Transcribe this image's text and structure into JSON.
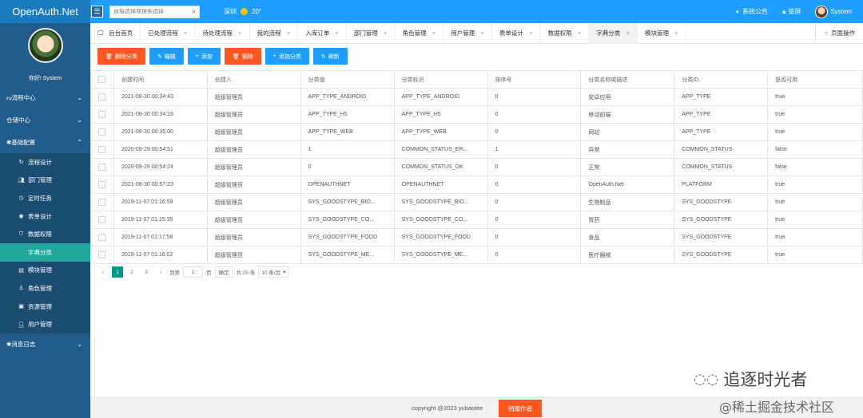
{
  "app": {
    "title": "OpenAuth.Net"
  },
  "header": {
    "search_placeholder": "直接选择或搜索选择",
    "weather": {
      "city": "深圳",
      "temp": "20°"
    },
    "notice": "系统公告",
    "lock": "锁屏",
    "user": "System"
  },
  "sidebar": {
    "greeting": "你好! System",
    "groups": [
      {
        "label": "流程中心",
        "expanded": false
      },
      {
        "label": "仓储中心",
        "expanded": false
      },
      {
        "label": "基础配置",
        "expanded": true
      },
      {
        "label": "消息日志",
        "expanded": false
      }
    ],
    "items": [
      {
        "label": "流程设计",
        "icon": "cycle-icon"
      },
      {
        "label": "部门管理",
        "icon": "users-icon"
      },
      {
        "label": "定时任务",
        "icon": "clock-icon"
      },
      {
        "label": "表单设计",
        "icon": "eye-icon"
      },
      {
        "label": "数据权限",
        "icon": "shield-icon"
      },
      {
        "label": "字典分类",
        "icon": "",
        "active": true
      },
      {
        "label": "模块管理",
        "icon": "list-icon"
      },
      {
        "label": "角色管理",
        "icon": "role-icon"
      },
      {
        "label": "资源管理",
        "icon": "resource-icon"
      },
      {
        "label": "用户管理",
        "icon": "user-icon"
      }
    ]
  },
  "tabs": [
    {
      "label": "后台首页",
      "closable": false
    },
    {
      "label": "已处理流程",
      "closable": true
    },
    {
      "label": "待处理流程",
      "closable": true
    },
    {
      "label": "我的流程",
      "closable": true
    },
    {
      "label": "入库订单",
      "closable": true
    },
    {
      "label": "部门管理",
      "closable": true
    },
    {
      "label": "角色管理",
      "closable": true
    },
    {
      "label": "用户管理",
      "closable": true
    },
    {
      "label": "表单设计",
      "closable": true
    },
    {
      "label": "数据权限",
      "closable": true
    },
    {
      "label": "字典分类",
      "closable": true,
      "active": true
    },
    {
      "label": "模块管理",
      "closable": true
    }
  ],
  "tab_ops": "页面操作",
  "toolbar": {
    "delete_category": "删除分类",
    "edit": "编辑",
    "add": "添加",
    "delete": "删除",
    "add_category": "添加分类",
    "refresh": "刷新"
  },
  "table": {
    "columns": [
      "创建时间",
      "创建人",
      "分类值",
      "分类标识",
      "排序号",
      "分类名称或描述",
      "分类ID",
      "是否可用"
    ],
    "rows": [
      [
        "2021-08-30 00:34:43",
        "超级管理员",
        "APP_TYPE_ANDROID",
        "APP_TYPE_ANDROID",
        "0",
        "安卓应用",
        "APP_TYPE",
        "true"
      ],
      [
        "2021-08-30 00:34:19",
        "超级管理员",
        "APP_TYPE_H5",
        "APP_TYPE_H5",
        "0",
        "移动前端",
        "APP_TYPE",
        "true"
      ],
      [
        "2021-08-30 00:35:00",
        "超级管理员",
        "APP_TYPE_WEB",
        "APP_TYPE_WEB",
        "0",
        "网站",
        "APP_TYPE",
        "true"
      ],
      [
        "2020-09-29 00:54:51",
        "超级管理员",
        "1",
        "COMMON_STATUS_ER...",
        "1",
        "异常",
        "COMMON_STATUS",
        "false"
      ],
      [
        "2020-09-29 00:54:24",
        "超级管理员",
        "0",
        "COMMON_STATUS_OK",
        "0",
        "正常",
        "COMMON_STATUS",
        "false"
      ],
      [
        "2021-08-30 00:57:23",
        "超级管理员",
        "OPENAUTHNET",
        "OPENAUTHNET",
        "0",
        "OpenAuth.Net",
        "PLATFORM",
        "true"
      ],
      [
        "2019-11-07 01:16:59",
        "超级管理员",
        "SYS_GOODSTYPE_BIO...",
        "SYS_GOODSTYPE_BIO...",
        "0",
        "生物制品",
        "SYS_GOODSTYPE",
        "true"
      ],
      [
        "2019-11-07 01:15:35",
        "超级管理员",
        "SYS_GOODSTYPE_CO...",
        "SYS_GOODSTYPE_CO...",
        "0",
        "胃药",
        "SYS_GOODSTYPE",
        "true"
      ],
      [
        "2019-11-07 01:17:58",
        "超级管理员",
        "SYS_GOODSTYPE_FOOD",
        "SYS_GOODSTYPE_FOOD",
        "0",
        "食品",
        "SYS_GOODSTYPE",
        "true"
      ],
      [
        "2019-11-07 01:16:02",
        "超级管理员",
        "SYS_GOODSTYPE_ME...",
        "SYS_GOODSTYPE_ME...",
        "0",
        "医疗器械",
        "SYS_GOODSTYPE",
        "true"
      ]
    ]
  },
  "pager": {
    "prev": "‹",
    "pages": [
      "1",
      "2",
      "3"
    ],
    "current": "1",
    "next": "›",
    "goto_label": "到第",
    "goto_value": "1",
    "page_unit": "页",
    "confirm": "确定",
    "total": "共 25 条",
    "page_size": "10 条/页"
  },
  "footer": {
    "copyright": "copyright @2023 yubaolee",
    "donate": "捐赠作者"
  },
  "watermark": {
    "line1": "追逐时光者",
    "line2": "@稀土掘金技术社区"
  }
}
